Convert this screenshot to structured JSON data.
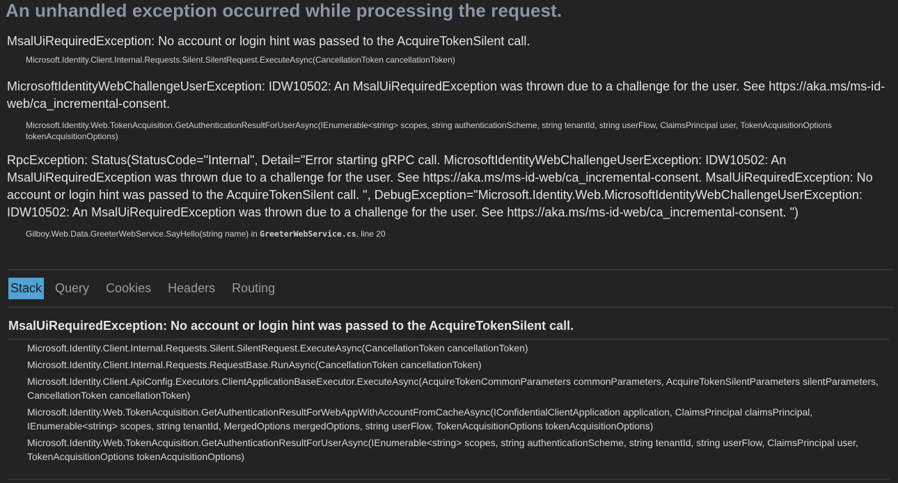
{
  "page": {
    "title": "An unhandled exception occurred while processing the request."
  },
  "exceptions": [
    {
      "message": "MsalUiRequiredException: No account or login hint was passed to the AcquireTokenSilent call.",
      "location": "Microsoft.Identity.Client.Internal.Requests.Silent.SilentRequest.ExecuteAsync(CancellationToken cancellationToken)"
    },
    {
      "message": "MicrosoftIdentityWebChallengeUserException: IDW10502: An MsalUiRequiredException was thrown due to a challenge for the user. See https://aka.ms/ms-id-web/ca_incremental-consent.",
      "location": "Microsoft.Identity.Web.TokenAcquisition.GetAuthenticationResultForUserAsync(IEnumerable<string> scopes, string authenticationScheme, string tenantId, string userFlow, ClaimsPrincipal user, TokenAcquisitionOptions tokenAcquisitionOptions)"
    },
    {
      "message": "RpcException: Status(StatusCode=\"Internal\", Detail=\"Error starting gRPC call. MicrosoftIdentityWebChallengeUserException: IDW10502: An MsalUiRequiredException was thrown due to a challenge for the user. See https://aka.ms/ms-id-web/ca_incremental-consent. MsalUiRequiredException: No account or login hint was passed to the AcquireTokenSilent call. \", DebugException=\"Microsoft.Identity.Web.MicrosoftIdentityWebChallengeUserException: IDW10502: An MsalUiRequiredException was thrown due to a challenge for the user. See https://aka.ms/ms-id-web/ca_incremental-consent. \")",
      "location_prefix": "Gilboy.Web.Data.GreeterWebService.SayHello(string name) in ",
      "location_file": "GreeterWebService.cs",
      "location_suffix": ", line 20"
    }
  ],
  "tabs": {
    "stack": "Stack",
    "query": "Query",
    "cookies": "Cookies",
    "headers": "Headers",
    "routing": "Routing"
  },
  "stack": {
    "title": "MsalUiRequiredException: No account or login hint was passed to the AcquireTokenSilent call.",
    "frames": [
      "Microsoft.Identity.Client.Internal.Requests.Silent.SilentRequest.ExecuteAsync(CancellationToken cancellationToken)",
      "Microsoft.Identity.Client.Internal.Requests.RequestBase.RunAsync(CancellationToken cancellationToken)",
      "Microsoft.Identity.Client.ApiConfig.Executors.ClientApplicationBaseExecutor.ExecuteAsync(AcquireTokenCommonParameters commonParameters, AcquireTokenSilentParameters silentParameters, CancellationToken cancellationToken)",
      "Microsoft.Identity.Web.TokenAcquisition.GetAuthenticationResultForWebAppWithAccountFromCacheAsync(IConfidentialClientApplication application, ClaimsPrincipal claimsPrincipal, IEnumerable<string> scopes, string tenantId, MergedOptions mergedOptions, string userFlow, TokenAcquisitionOptions tokenAcquisitionOptions)",
      "Microsoft.Identity.Web.TokenAcquisition.GetAuthenticationResultForUserAsync(IEnumerable<string> scopes, string authenticationScheme, string tenantId, string userFlow, ClaimsPrincipal user, TokenAcquisitionOptions tokenAcquisitionOptions)"
    ]
  }
}
